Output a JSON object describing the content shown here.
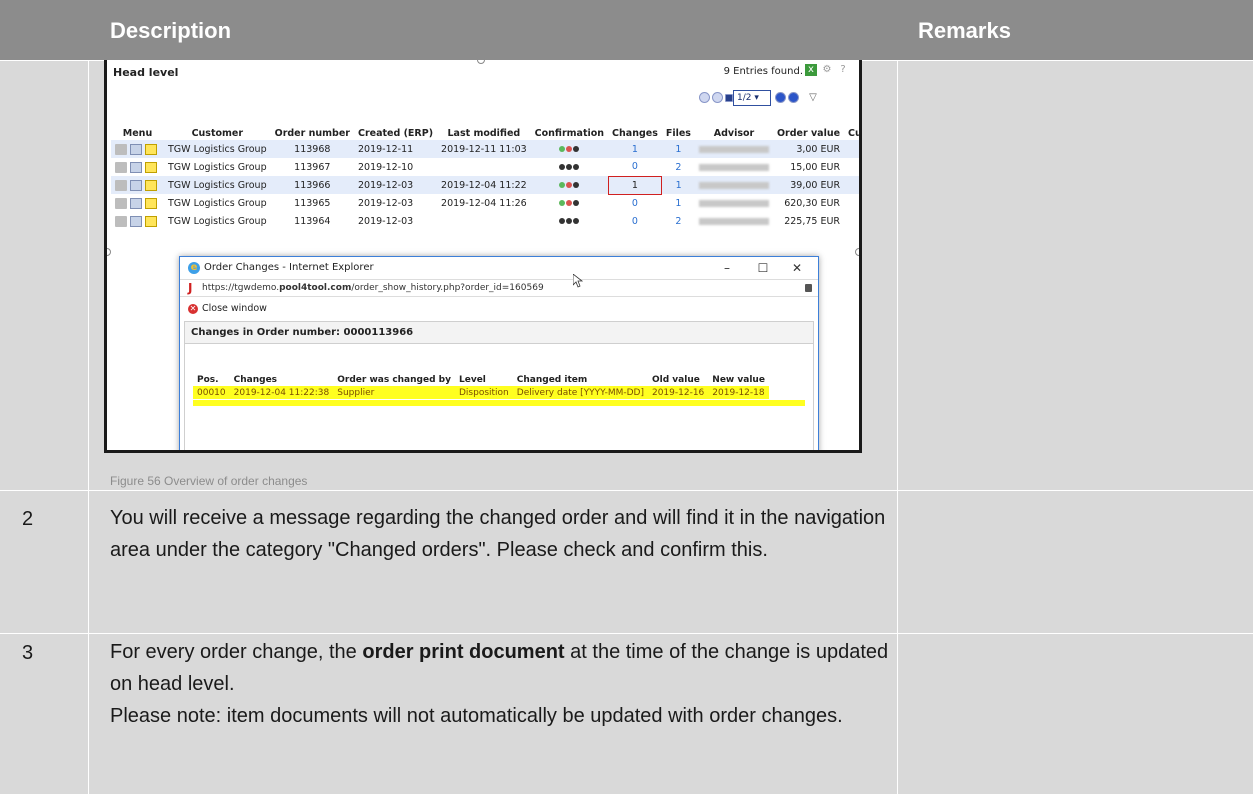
{
  "header": {
    "description": "Description",
    "remarks": "Remarks"
  },
  "figure": {
    "caption": "Figure 56 Overview of order changes",
    "head_level": "Head level",
    "entries_found": "9 Entries found.",
    "pager": "1/2",
    "columns": [
      "Menu",
      "Customer",
      "Order number",
      "Created (ERP)",
      "Last modified",
      "Confirmation",
      "Changes",
      "Files",
      "Advisor",
      "Order value",
      "Cu"
    ],
    "orders": [
      {
        "customer": "TGW Logistics Group",
        "order_number": "113968",
        "created": "2019-12-11",
        "last_modified": "2019-12-11 11:03",
        "changes": "1",
        "files": "1",
        "value": "3,00 EUR"
      },
      {
        "customer": "TGW Logistics Group",
        "order_number": "113967",
        "created": "2019-12-10",
        "last_modified": "",
        "changes": "0",
        "files": "2",
        "value": "15,00 EUR"
      },
      {
        "customer": "TGW Logistics Group",
        "order_number": "113966",
        "created": "2019-12-03",
        "last_modified": "2019-12-04 11:22",
        "changes": "1",
        "files": "1",
        "value": "39,00 EUR"
      },
      {
        "customer": "TGW Logistics Group",
        "order_number": "113965",
        "created": "2019-12-03",
        "last_modified": "2019-12-04 11:26",
        "changes": "0",
        "files": "1",
        "value": "620,30 EUR"
      },
      {
        "customer": "TGW Logistics Group",
        "order_number": "113964",
        "created": "2019-12-03",
        "last_modified": "",
        "changes": "0",
        "files": "2",
        "value": "225,75 EUR"
      }
    ],
    "popup": {
      "title": "Order Changes - Internet Explorer",
      "url_prefix": "https://tgwdemo.",
      "url_domain": "pool4tool.com",
      "url_path": "/order_show_history.php?order_id=160569",
      "close_window": "Close window",
      "heading": "Changes in Order number: 0000113966",
      "columns": [
        "Pos.",
        "Changes",
        "Order was changed by",
        "Level",
        "Changed item",
        "Old value",
        "New value"
      ],
      "row": {
        "pos": "00010",
        "changes": "2019-12-04 11:22:38",
        "changed_by": "Supplier",
        "level": "Disposition",
        "item": "Delivery date [YYYY-MM-DD]",
        "old": "2019-12-16",
        "new": "2019-12-18"
      }
    }
  },
  "rows": [
    {
      "num": "2",
      "text": "You will receive a message regarding the changed order and will find it in the navigation area under the category \"Changed orders\". Please check and confirm this."
    },
    {
      "num": "3",
      "text_before": "For every order change, the ",
      "text_bold": "order print document",
      "text_after": " at the time of the change is updated on head level.",
      "note": "Please note: item documents will not automatically be updated with order changes."
    }
  ]
}
